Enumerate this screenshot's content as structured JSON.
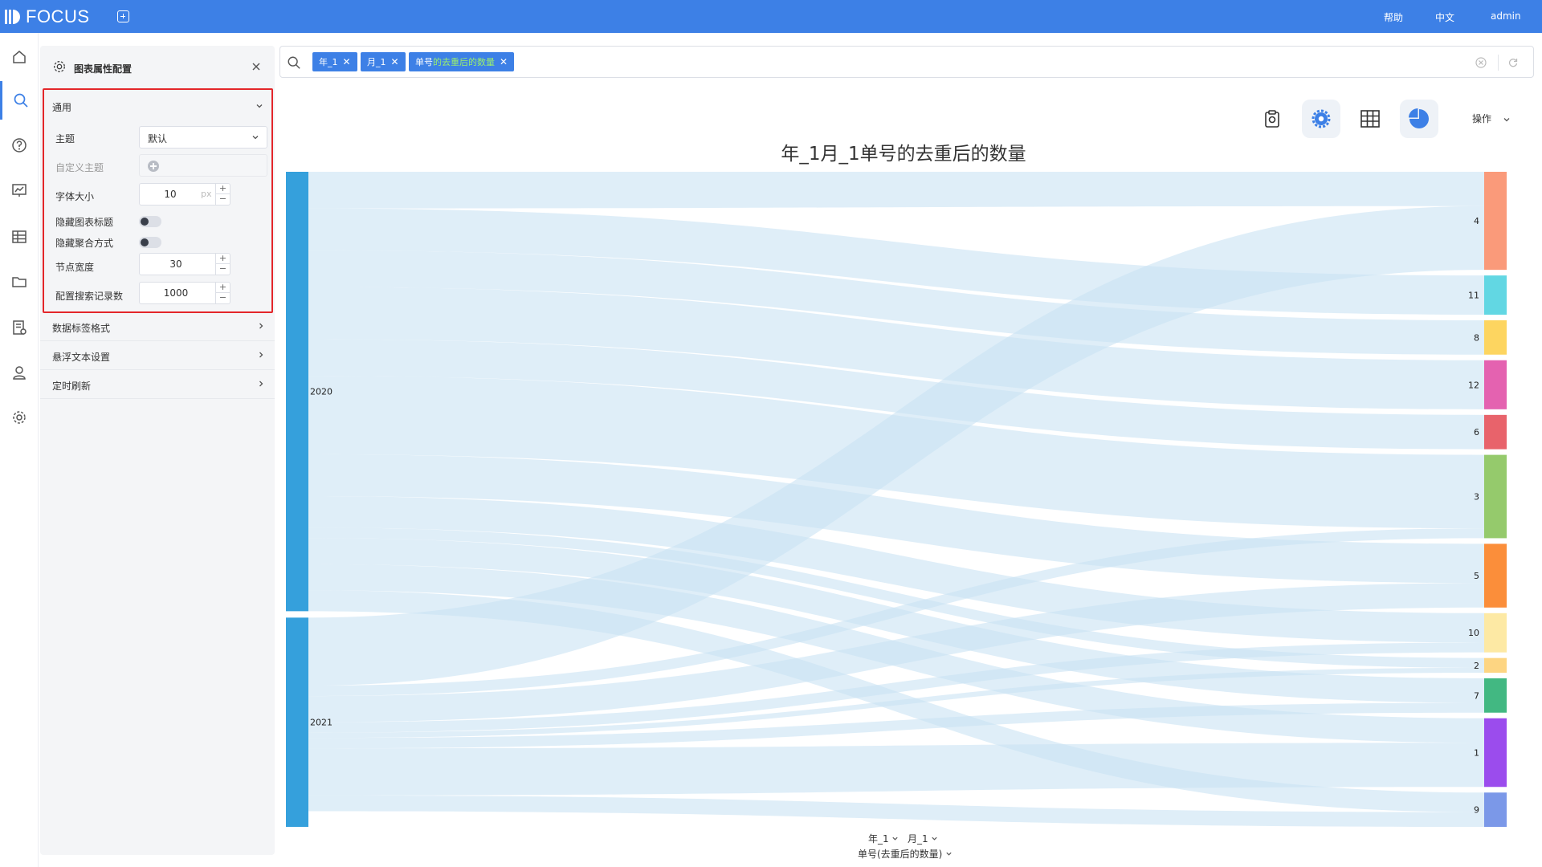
{
  "app": {
    "logo": "FOCUS",
    "nav_right": {
      "help": "帮助",
      "lang": "中文",
      "user": "admin"
    }
  },
  "rail": {
    "items": [
      "home-icon",
      "search-icon",
      "help-icon",
      "dashboard-icon",
      "table-icon",
      "folder-icon",
      "report-settings-icon",
      "user-icon",
      "settings-icon"
    ],
    "active": "search-icon"
  },
  "panel": {
    "title": "图表属性配置",
    "general": {
      "title": "通用",
      "theme_label": "主题",
      "theme_value": "默认",
      "custom_theme_label": "自定义主题",
      "font_size_label": "字体大小",
      "font_size_value": "10",
      "font_size_unit": "px",
      "hide_title_label": "隐藏图表标题",
      "hide_aggregation_label": "隐藏聚合方式",
      "node_width_label": "节点宽度",
      "node_width_value": "30",
      "max_records_label": "配置搜索记录数",
      "max_records_value": "1000"
    },
    "sections": [
      "数据标签格式",
      "悬浮文本设置",
      "定时刷新"
    ]
  },
  "search": {
    "chips": [
      {
        "text": "年_1"
      },
      {
        "text": "月_1"
      },
      {
        "prefix": "单号",
        "highlight": "的去重后的数量"
      }
    ]
  },
  "toolbar": {
    "ops_label": "操作",
    "buttons": [
      "clipboard-icon",
      "settings-icon",
      "table-icon",
      "pie-chart-icon"
    ]
  },
  "chart_data": {
    "type": "sankey",
    "title": "年_1月_1单号的去重后的数量",
    "source_nodes": [
      {
        "name": "2020",
        "value": 84,
        "color": "#35a0dc"
      },
      {
        "name": "2021",
        "value": 40,
        "color": "#35a0dc"
      }
    ],
    "target_nodes": [
      {
        "name": "4",
        "value": 20,
        "color": "#fa9a7a"
      },
      {
        "name": "11",
        "value": 8,
        "color": "#62d7e3"
      },
      {
        "name": "8",
        "value": 7,
        "color": "#fdd560"
      },
      {
        "name": "12",
        "value": 10,
        "color": "#e462b0"
      },
      {
        "name": "6",
        "value": 7,
        "color": "#e8636b"
      },
      {
        "name": "3",
        "value": 17,
        "color": "#95ca6c"
      },
      {
        "name": "5",
        "value": 13,
        "color": "#fb8e3a"
      },
      {
        "name": "10",
        "value": 8,
        "color": "#fde9a4"
      },
      {
        "name": "2",
        "value": 3,
        "color": "#fdd582"
      },
      {
        "name": "7",
        "value": 7,
        "color": "#42b882"
      },
      {
        "name": "1",
        "value": 14,
        "color": "#9b4ced"
      },
      {
        "name": "9",
        "value": 7,
        "color": "#7b98e8"
      }
    ],
    "links": [
      {
        "source": "2020",
        "target": "4",
        "value": 7
      },
      {
        "source": "2020",
        "target": "11",
        "value": 8
      },
      {
        "source": "2020",
        "target": "8",
        "value": 7
      },
      {
        "source": "2020",
        "target": "12",
        "value": 10
      },
      {
        "source": "2020",
        "target": "6",
        "value": 7
      },
      {
        "source": "2020",
        "target": "3",
        "value": 15
      },
      {
        "source": "2020",
        "target": "5",
        "value": 8
      },
      {
        "source": "2020",
        "target": "10",
        "value": 6
      },
      {
        "source": "2020",
        "target": "2",
        "value": 2
      },
      {
        "source": "2020",
        "target": "7",
        "value": 5
      },
      {
        "source": "2020",
        "target": "1",
        "value": 5
      },
      {
        "source": "2020",
        "target": "9",
        "value": 4
      },
      {
        "source": "2021",
        "target": "4",
        "value": 13
      },
      {
        "source": "2021",
        "target": "3",
        "value": 2
      },
      {
        "source": "2021",
        "target": "5",
        "value": 5
      },
      {
        "source": "2021",
        "target": "10",
        "value": 2
      },
      {
        "source": "2021",
        "target": "2",
        "value": 1
      },
      {
        "source": "2021",
        "target": "7",
        "value": 2
      },
      {
        "source": "2021",
        "target": "1",
        "value": 9
      },
      {
        "source": "2021",
        "target": "9",
        "value": 3
      }
    ],
    "link_color": "#c9e3f3",
    "axis_fields": [
      "年_1",
      "月_1"
    ],
    "value_field": "单号(去重后的数量)"
  }
}
